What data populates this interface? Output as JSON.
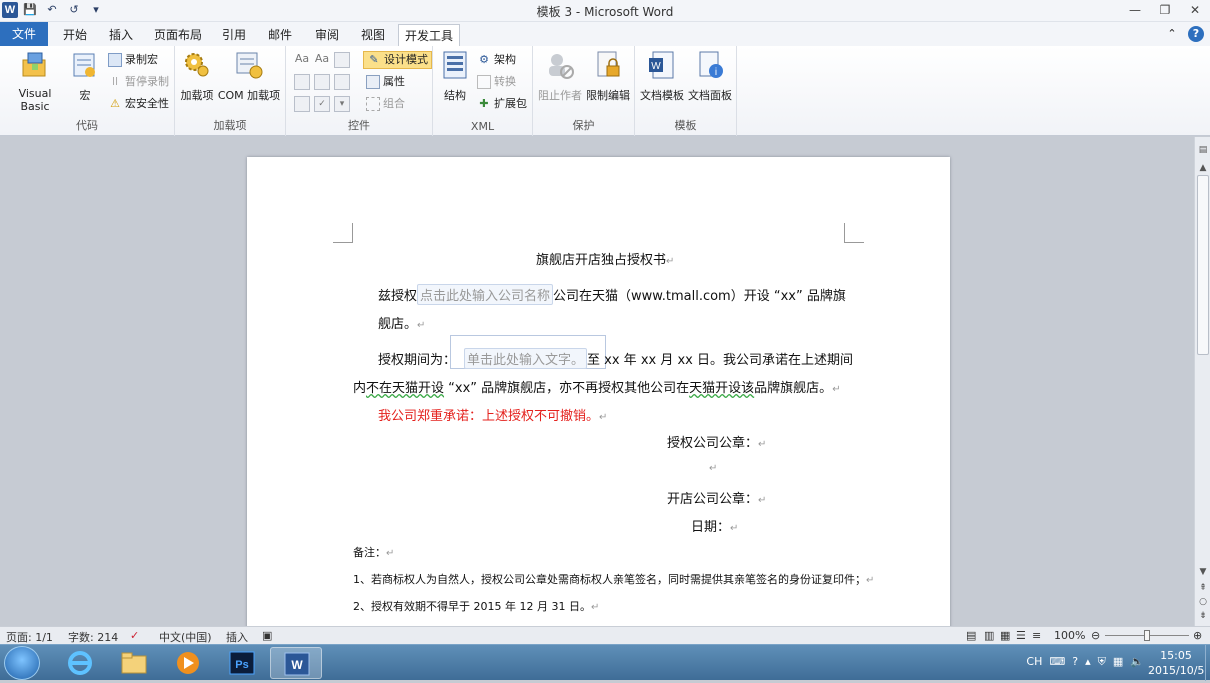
{
  "window": {
    "app_icon_letter": "W",
    "title": "模板 3  -  Microsoft Word",
    "controls": {
      "minimize": "—",
      "restore": "❐",
      "close": "✕"
    }
  },
  "qat": {
    "save": "💾",
    "undo": "↶",
    "redo": "↺",
    "customize": "▾"
  },
  "tabs": [
    "文件",
    "开始",
    "插入",
    "页面布局",
    "引用",
    "邮件",
    "审阅",
    "视图",
    "开发工具"
  ],
  "ribbon": {
    "groups": {
      "code": "代码",
      "addins": "加载项",
      "controls": "控件",
      "xml": "XML",
      "protect": "保护",
      "templates": "模板"
    },
    "code": {
      "visual_basic": "Visual Basic",
      "macros": "宏",
      "record_macro": "录制宏",
      "pause_recording": "暂停录制",
      "macro_security": "宏安全性"
    },
    "addins": {
      "addins": "加载项",
      "com_addins": "COM 加载项"
    },
    "controls": {
      "design_mode": "设计模式",
      "properties": "属性",
      "group": "组合"
    },
    "xml": {
      "structure": "结构",
      "schema": "架构",
      "transform": "转换",
      "expansion_packs": "扩展包"
    },
    "protect": {
      "block_authors": "阻止作者",
      "restrict_editing": "限制编辑"
    },
    "templates": {
      "document_template": "文档模板",
      "document_panel": "文档面板"
    }
  },
  "document": {
    "title": "旗舰店开店独占授权书",
    "para1_prefix": "兹授权",
    "cc_company": "点击此处输入公司名称",
    "para1_suffix": "公司在天猫（www.tmall.com）开设 “xx” 品牌旗",
    "para1_line2": "舰店。",
    "para2_prefix": "授权期间为：",
    "cc_text": "单击此处输入文字。",
    "para2_suffix": "至 xx 年 xx 月 xx 日。我公司承诺在上述期间",
    "para2_line2_a": "内",
    "para2_line2_b": "不在天猫开设",
    "para2_line2_c": " “xx” 品牌旗舰店，亦不再授权其他公司在",
    "para2_line2_d": "天猫开设该",
    "para2_line2_e": "品牌旗舰店。",
    "commitment": "我公司郑重承诺：上述授权不可撤销。",
    "seal_auth": "授权公司公章：",
    "seal_store": "开店公司公章：",
    "date": "日期：",
    "notes_title": "备注：",
    "note1": "1、若商标权人为自然人，授权公司公章处需商标权人亲笔签名，同时需提供其亲笔签名的身份证复印件；",
    "note2": "2、授权有效期不得早于 2015 年 12 月 31 日。",
    "para_mark": "↵"
  },
  "statusbar": {
    "page": "页面: 1/1",
    "words": "字数: 214",
    "language": "中文(中国)",
    "insert_mode": "插入",
    "zoom": "100%"
  },
  "taskbar": {
    "ime": "CH",
    "time": "15:05",
    "date": "2015/10/5"
  },
  "colors": {
    "accent": "#2d6fbe",
    "red_text": "#e4211d",
    "design_mode_bg": "#fbe08a"
  }
}
